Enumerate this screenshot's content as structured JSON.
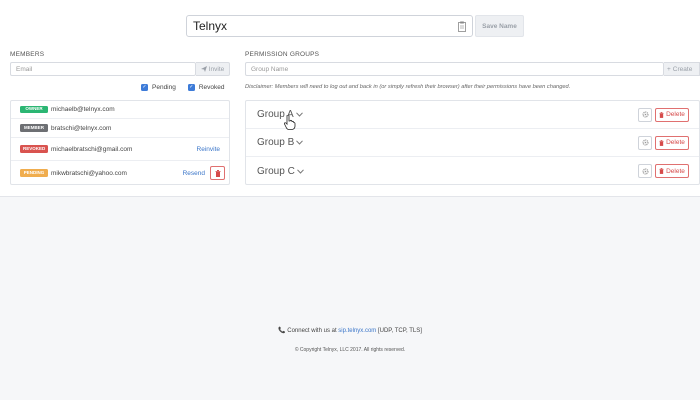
{
  "header": {
    "account_name": "Telnyx",
    "save_label": "Save Name"
  },
  "members": {
    "title": "MEMBERS",
    "email_placeholder": "Email",
    "invite_label": "Invite",
    "filters": [
      {
        "label": "Pending",
        "checked": true
      },
      {
        "label": "Revoked",
        "checked": true
      }
    ],
    "rows": [
      {
        "status": "OWNER",
        "color": "#2bb673",
        "email": "michaelb@telnyx.com",
        "action": ""
      },
      {
        "status": "MEMBER",
        "color": "#6d6f73",
        "email": "bratschi@telnyx.com",
        "action": ""
      },
      {
        "status": "REVOKED",
        "color": "#d9534f",
        "email": "michaelbratschi@gmail.com",
        "action": "Reinvite"
      },
      {
        "status": "PENDING",
        "color": "#f0ad4e",
        "email": "mikwbratschi@yahoo.com",
        "action": "Resend"
      }
    ]
  },
  "permission_groups": {
    "title": "PERMISSION GROUPS",
    "name_placeholder": "Group Name",
    "create_label": "Create",
    "disclaimer": "Disclaimer: Members will need to log out and back in (or simply refresh their browser) after their permissions have been changed.",
    "groups": [
      {
        "name": "Group A"
      },
      {
        "name": "Group B"
      },
      {
        "name": "Group C"
      }
    ],
    "delete_label": "Delete"
  },
  "footer": {
    "connect_prefix": "Connect with us at",
    "connect_link": "sip.telnyx.com",
    "connect_suffix": "[UDP, TCP, TLS]",
    "copyright": "© Copyright Telnyx, LLC 2017. All rights reserved."
  },
  "colors": {
    "accent": "#3b76c9",
    "danger": "#d64a4a",
    "checkbox": "#3d7bd8"
  }
}
